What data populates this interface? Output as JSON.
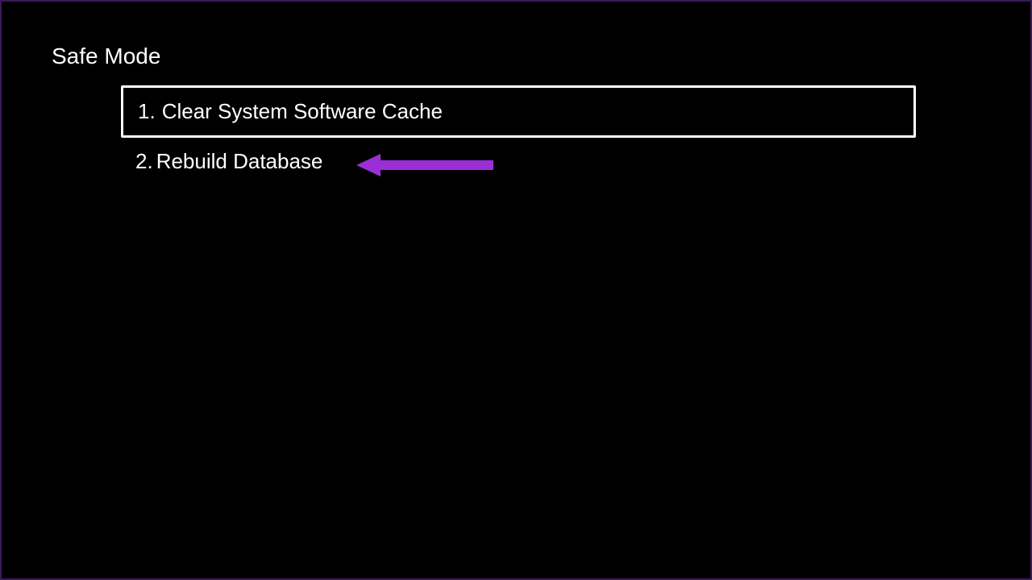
{
  "title": "Safe Mode",
  "menu": {
    "items": [
      {
        "num": "1.",
        "label": "Clear System Software Cache",
        "selected": true
      },
      {
        "num": "2.",
        "label": "Rebuild Database",
        "selected": false
      }
    ]
  },
  "annotation": {
    "arrow_color": "#9b2fd6"
  }
}
